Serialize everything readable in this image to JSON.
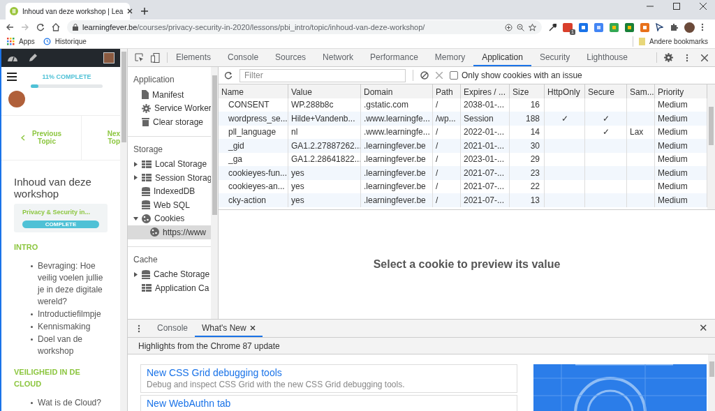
{
  "browser": {
    "tab": {
      "title": "Inhoud van deze workshop | Lea"
    },
    "url_host": "learningfever.be",
    "url_path": "/courses/privacy-security-in-2020/lessons/pbi_intro/topic/inhoud-van-deze-workshop/",
    "bookmarks": [
      "Apps",
      "Historique"
    ],
    "other_bookmarks": "Andere bookmarks",
    "extension_badge": "1"
  },
  "site": {
    "progress": {
      "label": "11% COMPLETE",
      "level": 0.11
    },
    "previous": "Previous\nTopic",
    "next": "Nex\nTop",
    "title": "Inhoud van deze workshop",
    "course": {
      "name": "Privacy & Security in...",
      "status": "COMPLETE"
    },
    "sections": [
      {
        "heading": "INTRO",
        "items": [
          "Bevraging: Hoe veilig voelen jullie je in deze digitale wereld?",
          "Introductiefilmpje",
          "Kennismaking",
          "Doel van de workshop"
        ]
      },
      {
        "heading": "VEILIGHEID IN DE CLOUD",
        "items": [
          "Wat is de Cloud?"
        ]
      }
    ]
  },
  "devtools": {
    "tabs": [
      {
        "label": "Elements",
        "selected": false
      },
      {
        "label": "Console",
        "selected": false
      },
      {
        "label": "Sources",
        "selected": false
      },
      {
        "label": "Network",
        "selected": false
      },
      {
        "label": "Performance",
        "selected": false
      },
      {
        "label": "Memory",
        "selected": false
      },
      {
        "label": "Application",
        "selected": true
      },
      {
        "label": "Security",
        "selected": false
      },
      {
        "label": "Lighthouse",
        "selected": false
      }
    ],
    "sidebar": [
      {
        "heading": "Application",
        "items": [
          {
            "label": "Manifest",
            "kind": "file",
            "selected": false
          },
          {
            "label": "Service Worker",
            "kind": "gear",
            "selected": false
          },
          {
            "label": "Clear storage",
            "kind": "trash",
            "selected": false
          }
        ]
      },
      {
        "heading": "Storage",
        "items": [
          {
            "label": "Local Storage",
            "kind": "grid",
            "expanded": false,
            "selected": false
          },
          {
            "label": "Session Storag",
            "kind": "grid",
            "expanded": false,
            "selected": false
          },
          {
            "label": "IndexedDB",
            "kind": "db",
            "selected": false
          },
          {
            "label": "Web SQL",
            "kind": "db",
            "selected": false
          },
          {
            "label": "Cookies",
            "kind": "cookie",
            "expanded": true,
            "selected": false,
            "children": [
              {
                "label": "https://www",
                "kind": "cookie",
                "selected": true
              }
            ]
          }
        ]
      },
      {
        "heading": "Cache",
        "items": [
          {
            "label": "Cache Storage",
            "kind": "db",
            "expanded": false,
            "selected": false
          },
          {
            "label": "Application Ca",
            "kind": "grid",
            "selected": false
          }
        ]
      }
    ],
    "filter": {
      "placeholder": "Filter"
    },
    "only_issues": {
      "label": "Only show cookies with an issue",
      "checked": false
    },
    "table": {
      "columns": [
        "Name",
        "Value",
        "Domain",
        "Path",
        "Expires / ...",
        "Size",
        "HttpOnly",
        "Secure",
        "Sam...",
        "Priority"
      ],
      "rows": [
        [
          "CONSENT",
          "WP.288b8c",
          ".gstatic.com",
          "/",
          "2038-01-...",
          "16",
          "",
          "",
          "",
          "Medium"
        ],
        [
          "wordpress_se...",
          "Hilde+Vandenb...",
          ".www.learningfe...",
          "/wp...",
          "Session",
          "188",
          "✓",
          "✓",
          "",
          "Medium"
        ],
        [
          "pll_language",
          "nl",
          ".www.learningfe...",
          "/",
          "2022-01-...",
          "14",
          "",
          "✓",
          "Lax",
          "Medium"
        ],
        [
          "_gid",
          "GA1.2.27887262...",
          ".learningfever.be",
          "/",
          "2021-01-...",
          "30",
          "",
          "",
          "",
          "Medium"
        ],
        [
          "_ga",
          "GA1.2.28641822...",
          ".learningfever.be",
          "/",
          "2023-01-...",
          "29",
          "",
          "",
          "",
          "Medium"
        ],
        [
          "cookieyes-fun...",
          "yes",
          ".learningfever.be",
          "/",
          "2021-07-...",
          "23",
          "",
          "",
          "",
          "Medium"
        ],
        [
          "cookieyes-an...",
          "yes",
          ".learningfever.be",
          "/",
          "2021-07-...",
          "22",
          "",
          "",
          "",
          "Medium"
        ],
        [
          "cky-action",
          "yes",
          ".learningfever.be",
          "/",
          "2021-07-...",
          "13",
          "",
          "",
          "",
          "Medium"
        ]
      ]
    },
    "preview_message": "Select a cookie to preview its value",
    "drawer": {
      "tabs": [
        {
          "label": "Console",
          "selected": false,
          "closable": false
        },
        {
          "label": "What's New",
          "selected": true,
          "closable": true
        }
      ],
      "close": "✕",
      "heading": "Highlights from the Chrome 87 update",
      "cards": [
        {
          "title": "New CSS Grid debugging tools",
          "text": "Debug and inspect CSS Grid with the new CSS Grid debugging tools."
        },
        {
          "title": "New WebAuthn tab"
        }
      ]
    }
  }
}
